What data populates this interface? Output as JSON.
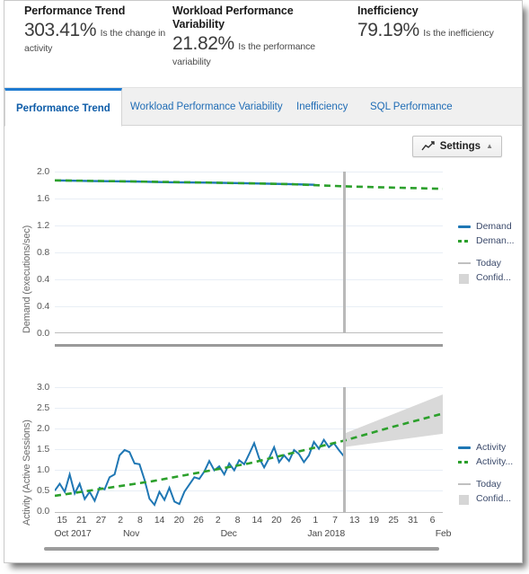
{
  "kpis": [
    {
      "title": "Performance Trend",
      "value": "303.41%",
      "caption": "Is the change in activity"
    },
    {
      "title": "Workload Performance Variability",
      "value": "21.82%",
      "caption": "Is the performance variability"
    },
    {
      "title": "Inefficiency",
      "value": "79.19%",
      "caption": "Is the inefficiency"
    }
  ],
  "tabs": [
    {
      "label": "Performance Trend",
      "active": true
    },
    {
      "label": "Workload Performance Variability",
      "active": false
    },
    {
      "label": "Inefficiency",
      "active": false
    },
    {
      "label": "SQL Performance",
      "active": false
    }
  ],
  "toolbar": {
    "settings_label": "Settings",
    "settings_icon": "line-chart-icon",
    "caret_glyph": "▲"
  },
  "colors": {
    "accent_blue": "#1f77b4",
    "trend_green": "#2ca02c",
    "today_gray": "#b9b9b9",
    "confidence_gray": "#d6d6d6",
    "tab_active_blue": "#1f7bd1",
    "grid": "#e8eef5"
  },
  "chart_data": [
    {
      "type": "line",
      "title": "",
      "ylabel": "Demand (executions/sec)",
      "xlabel": "",
      "ylim": [
        0.0,
        2.2
      ],
      "yticks": [
        "2.0",
        "1.6",
        "1.2",
        "0.8",
        "0.4",
        "0.4",
        "0.0"
      ],
      "ytick_values": [
        2.0,
        1.6,
        1.2,
        0.8,
        0.4,
        0.4,
        0.0
      ],
      "grid": true,
      "legend_position": "right",
      "legend": [
        {
          "label": "Demand",
          "style": "solid",
          "color": "#1f77b4"
        },
        {
          "label": "Deman...",
          "style": "dashed",
          "color": "#2ca02c"
        },
        {
          "label": "Today",
          "style": "solid",
          "color": "#c0c0c0"
        },
        {
          "label": "Confid...",
          "style": "box",
          "color": "#d6d6d6"
        }
      ],
      "today_x_fraction": 0.745,
      "series": [
        {
          "name": "Demand",
          "style": "solid",
          "color": "#1f77b4",
          "x_fractions": [
            0.0,
            0.1,
            0.2,
            0.3,
            0.4,
            0.5,
            0.6,
            0.67
          ],
          "values": [
            2.08,
            2.07,
            2.065,
            2.055,
            2.05,
            2.04,
            2.03,
            2.02
          ]
        },
        {
          "name": "Demand Trend",
          "style": "dashed",
          "color": "#2ca02c",
          "x_fractions": [
            0.0,
            0.2,
            0.4,
            0.6,
            0.745,
            0.85,
            1.0
          ],
          "values": [
            2.08,
            2.065,
            2.05,
            2.03,
            2.0,
            1.985,
            1.965
          ]
        }
      ]
    },
    {
      "type": "line",
      "title": "",
      "ylabel": "Activity (Active Sessions)",
      "xlabel": "",
      "ylim": [
        0.0,
        3.1
      ],
      "yticks": [
        "3.0",
        "2.5",
        "2.0",
        "1.5",
        "1.0",
        "0.5",
        "0.0"
      ],
      "ytick_values": [
        3.0,
        2.5,
        2.0,
        1.5,
        1.0,
        0.5,
        0.0
      ],
      "grid": true,
      "legend_position": "right",
      "legend": [
        {
          "label": "Activity",
          "style": "solid",
          "color": "#1f77b4"
        },
        {
          "label": "Activity...",
          "style": "dashed",
          "color": "#2ca02c"
        },
        {
          "label": "Today",
          "style": "solid",
          "color": "#c0c0c0"
        },
        {
          "label": "Confid...",
          "style": "box",
          "color": "#d6d6d6"
        }
      ],
      "today_x_fraction": 0.745,
      "series": [
        {
          "name": "Activity",
          "style": "solid",
          "color": "#1f77b4",
          "values": [
            0.55,
            0.72,
            0.52,
            0.95,
            0.48,
            0.72,
            0.34,
            0.52,
            0.3,
            0.62,
            0.58,
            0.88,
            0.95,
            1.42,
            1.55,
            1.5,
            1.22,
            1.2,
            0.82,
            0.35,
            0.2,
            0.52,
            0.32,
            0.62,
            0.28,
            0.22,
            0.52,
            0.7,
            0.88,
            0.84,
            1.02,
            1.28,
            1.05,
            1.15,
            0.95,
            1.22,
            1.05,
            1.3,
            1.2,
            1.45,
            1.72,
            1.35,
            1.12,
            1.35,
            1.62,
            1.25,
            1.42,
            1.28,
            1.55,
            1.45,
            1.25,
            1.42,
            1.75,
            1.58,
            1.8,
            1.62,
            1.72,
            1.55,
            1.4
          ]
        },
        {
          "name": "Activity Trend",
          "style": "dashed",
          "color": "#2ca02c",
          "x_fractions": [
            0.0,
            0.25,
            0.5,
            0.745,
            0.87,
            1.0
          ],
          "values": [
            0.42,
            0.78,
            1.22,
            1.78,
            2.12,
            2.45
          ]
        }
      ],
      "confidence_band": {
        "label": "Confidence interval",
        "color": "#d6d6d6",
        "x_fractions": [
          0.745,
          1.0
        ],
        "lower": [
          1.62,
          1.95
        ],
        "upper": [
          1.95,
          2.92
        ]
      }
    }
  ],
  "xaxis": {
    "ticks": [
      "15",
      "21",
      "27",
      "2",
      "8",
      "14",
      "20",
      "26",
      "2",
      "8",
      "14",
      "20",
      "26",
      "1",
      "7",
      "13",
      "19",
      "25",
      "31",
      "6"
    ],
    "months": [
      {
        "label": "Oct 2017",
        "tick_index": 0
      },
      {
        "label": "Nov",
        "tick_index": 3
      },
      {
        "label": "Dec",
        "tick_index": 8
      },
      {
        "label": "Jan 2018",
        "tick_index": 13
      },
      {
        "label": "Feb",
        "tick_index": 19
      }
    ]
  }
}
